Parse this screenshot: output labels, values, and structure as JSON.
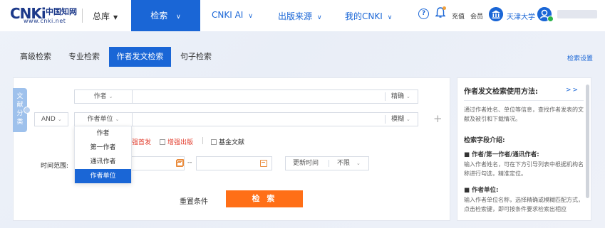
{
  "header": {
    "logo_text": "CNKi",
    "logo_chinese": "中国知网",
    "logo_url": "www.cnki.net",
    "library": "总库",
    "search": "检索",
    "nav": [
      "CNKI AI",
      "出版来源",
      "我的CNKI"
    ],
    "help": "?",
    "recharge": "充值",
    "member": "会员",
    "institution": "天津大学"
  },
  "tabs": [
    "高级检索",
    "专业检索",
    "作者发文检索",
    "句子检索"
  ],
  "active_tab": 2,
  "search_settings": "检索设置",
  "side_tab": [
    "文",
    "献",
    "分",
    "类"
  ],
  "rows": [
    {
      "field": "作者",
      "match": "精确"
    },
    {
      "logic": "AND",
      "field": "作者单位",
      "match": "模糊"
    }
  ],
  "options": [
    "增强首发",
    "增强出版",
    "基金文献"
  ],
  "time_label": "时间范围:",
  "date_dash": "--",
  "update_label": "更新时间",
  "update_value": "不限",
  "reset": "重置条件",
  "search_button": "检 索",
  "dropdown": {
    "items": [
      "作者",
      "第一作者",
      "通讯作者",
      "作者单位"
    ],
    "selected": 3
  },
  "help_panel": {
    "title": "作者发文检索使用方法:",
    "more": ">>",
    "intro": "通过作者姓名、单位等信息，查找作者发表的文献及被引和下载情况。",
    "fields_title": "检索字段介绍:",
    "f1_title": "■ 作者/第一作者/通讯作者:",
    "f1_text": "输入作者姓名，可在下方引导列表中根据机构名称进行勾选，精准定位。",
    "f2_title": "■ 作者单位:",
    "f2_text": "输入作者单位名称，选择精确或模糊匹配方式，点击检索键，即可按条件要求检索出相应"
  },
  "colors": {
    "brand": "#1a66d6",
    "accent": "#ff6f17"
  }
}
